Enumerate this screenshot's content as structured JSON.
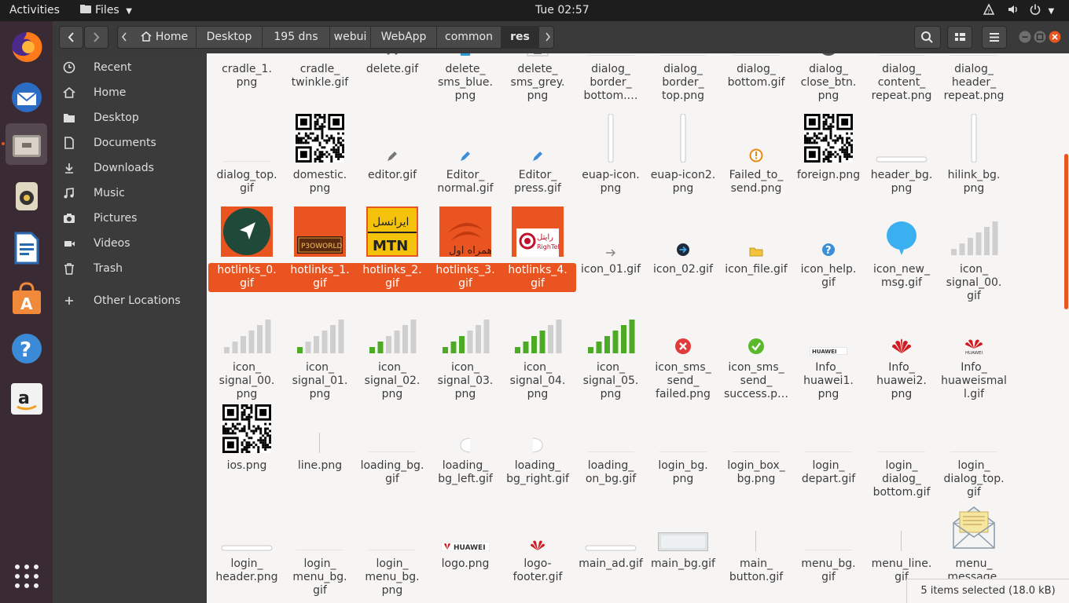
{
  "topbar": {
    "activities": "Activities",
    "app_menu": "Files",
    "clock": "Tue 02:57"
  },
  "dock": {
    "items": [
      "firefox-icon",
      "thunderbird-icon",
      "files-icon",
      "rhythmbox-icon",
      "libreoffice-writer-icon",
      "software-center-icon",
      "help-icon",
      "amazon-icon",
      "show-apps-icon"
    ]
  },
  "breadcrumbs": [
    "Home",
    "Desktop",
    "195 dns",
    "webui",
    "WebApp",
    "common",
    "res"
  ],
  "sidebar": {
    "items": [
      "Recent",
      "Home",
      "Desktop",
      "Documents",
      "Downloads",
      "Music",
      "Pictures",
      "Videos",
      "Trash"
    ],
    "other": "Other Locations"
  },
  "files": [
    {
      "name": "cradle_1.\npng",
      "icon": "tree",
      "sel": false
    },
    {
      "name": "cradle_\ntwinkle.gif",
      "icon": "tree",
      "sel": false
    },
    {
      "name": "delete.gif",
      "icon": "x-grey",
      "sel": false
    },
    {
      "name": "delete_\nsms_blue.\npng",
      "icon": "trash-blue",
      "sel": false
    },
    {
      "name": "delete_\nsms_grey.\npng",
      "icon": "trash-grey",
      "sel": false
    },
    {
      "name": "dialog_\nborder_\nbottom.…",
      "icon": "blank",
      "sel": false
    },
    {
      "name": "dialog_\nborder_\ntop.png",
      "icon": "blank",
      "sel": false
    },
    {
      "name": "dialog_\nbottom.gif",
      "icon": "blank",
      "sel": false
    },
    {
      "name": "dialog_\nclose_btn.\npng",
      "icon": "close-red",
      "sel": false
    },
    {
      "name": "dialog_\ncontent_\nrepeat.png",
      "icon": "blank",
      "sel": false
    },
    {
      "name": "dialog_\nheader_\nrepeat.png",
      "icon": "blank",
      "sel": false
    },
    {
      "name": "dialog_top.\ngif",
      "icon": "blank",
      "sel": false
    },
    {
      "name": "domestic.\npng",
      "icon": "qr",
      "sel": false
    },
    {
      "name": "editor.gif",
      "icon": "pencil-grey",
      "sel": false
    },
    {
      "name": "Editor_\nnormal.gif",
      "icon": "pencil-blue",
      "sel": false
    },
    {
      "name": "Editor_\npress.gif",
      "icon": "pencil-blue",
      "sel": false
    },
    {
      "name": "euap-icon.\npng",
      "icon": "vbar",
      "sel": false
    },
    {
      "name": "euap-icon2.\npng",
      "icon": "vbar",
      "sel": false
    },
    {
      "name": "Failed_to_\nsend.png",
      "icon": "warn-orange",
      "sel": false
    },
    {
      "name": "foreign.png",
      "icon": "qr",
      "sel": false
    },
    {
      "name": "header_bg.\npng",
      "icon": "hbar",
      "sel": false
    },
    {
      "name": "hilink_bg.\npng",
      "icon": "vbar",
      "sel": false
    },
    {
      "name": "hotlinks_0.\ngif",
      "icon": "hot0",
      "sel": true
    },
    {
      "name": "hotlinks_1.\ngif",
      "icon": "hot1",
      "sel": true
    },
    {
      "name": "hotlinks_2.\ngif",
      "icon": "hot2",
      "sel": true
    },
    {
      "name": "hotlinks_3.\ngif",
      "icon": "hot3",
      "sel": true
    },
    {
      "name": "hotlinks_4.\ngif",
      "icon": "hot4",
      "sel": true
    },
    {
      "name": "icon_01.gif",
      "icon": "arrow-white",
      "sel": false
    },
    {
      "name": "icon_02.gif",
      "icon": "arrow-dark",
      "sel": false
    },
    {
      "name": "icon_file.gif",
      "icon": "folder-small",
      "sel": false
    },
    {
      "name": "icon_help.\ngif",
      "icon": "help-small",
      "sel": false
    },
    {
      "name": "icon_new_\nmsg.gif",
      "icon": "bubble",
      "sel": false
    },
    {
      "name": "icon_\nsignal_00.\ngif",
      "icon": "sig0",
      "sel": false
    },
    {
      "name": "icon_\nsignal_00.\npng",
      "icon": "sig0",
      "sel": false
    },
    {
      "name": "icon_\nsignal_01.\npng",
      "icon": "sig1",
      "sel": false
    },
    {
      "name": "icon_\nsignal_02.\npng",
      "icon": "sig2",
      "sel": false
    },
    {
      "name": "icon_\nsignal_03.\npng",
      "icon": "sig3",
      "sel": false
    },
    {
      "name": "icon_\nsignal_04.\npng",
      "icon": "sig4",
      "sel": false
    },
    {
      "name": "icon_\nsignal_05.\npng",
      "icon": "sig5",
      "sel": false
    },
    {
      "name": "icon_sms_\nsend_\nfailed.png",
      "icon": "fail-red",
      "sel": false
    },
    {
      "name": "icon_sms_\nsend_\nsuccess.p…",
      "icon": "ok-green",
      "sel": false
    },
    {
      "name": "Info_\nhuawei1.\npng",
      "icon": "huawei-text",
      "sel": false
    },
    {
      "name": "Info_\nhuawei2.\npng",
      "icon": "huawei-logo",
      "sel": false
    },
    {
      "name": "Info_\nhuaweismal\nl.gif",
      "icon": "huawei-small",
      "sel": false
    },
    {
      "name": "ios.png",
      "icon": "qr",
      "sel": false
    },
    {
      "name": "line.png",
      "icon": "vline",
      "sel": false
    },
    {
      "name": "loading_bg.\ngif",
      "icon": "blank",
      "sel": false
    },
    {
      "name": "loading_\nbg_left.gif",
      "icon": "arc-left",
      "sel": false
    },
    {
      "name": "loading_\nbg_right.gif",
      "icon": "arc-right",
      "sel": false
    },
    {
      "name": "loading_\non_bg.gif",
      "icon": "blank",
      "sel": false
    },
    {
      "name": "login_bg.\npng",
      "icon": "blank",
      "sel": false
    },
    {
      "name": "login_box_\nbg.png",
      "icon": "blank",
      "sel": false
    },
    {
      "name": "login_\ndepart.gif",
      "icon": "blank",
      "sel": false
    },
    {
      "name": "login_\ndialog_\nbottom.gif",
      "icon": "blank",
      "sel": false
    },
    {
      "name": "login_\ndialog_top.\ngif",
      "icon": "blank",
      "sel": false
    },
    {
      "name": "login_\nheader.png",
      "icon": "hbar",
      "sel": false
    },
    {
      "name": "login_\nmenu_bg.\ngif",
      "icon": "blank",
      "sel": false
    },
    {
      "name": "login_\nmenu_bg.\npng",
      "icon": "blank",
      "sel": false
    },
    {
      "name": "logo.png",
      "icon": "huawei-banner",
      "sel": false
    },
    {
      "name": "logo-\nfooter.gif",
      "icon": "huawei-red",
      "sel": false
    },
    {
      "name": "main_ad.gif",
      "icon": "hbar",
      "sel": false
    },
    {
      "name": "main_bg.gif",
      "icon": "grey-box",
      "sel": false
    },
    {
      "name": "main_\nbutton.gif",
      "icon": "vline",
      "sel": false
    },
    {
      "name": "menu_bg.\ngif",
      "icon": "blank",
      "sel": false
    },
    {
      "name": "menu_line.\ngif",
      "icon": "vline",
      "sel": false
    },
    {
      "name": "menu_\nmessage.",
      "icon": "envelope",
      "sel": false
    }
  ],
  "status": "5 items selected (18.0 kB)",
  "colors": {
    "accent": "#e95420",
    "dock": "#3a2a33",
    "sidebar": "#3b3b3b"
  }
}
